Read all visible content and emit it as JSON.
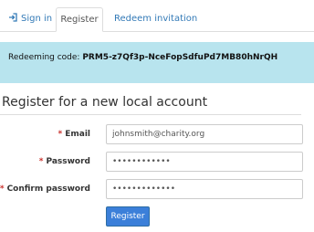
{
  "tabs": [
    {
      "label": "Sign in",
      "icon": "sign-in-icon",
      "active": false
    },
    {
      "label": "Register",
      "active": true
    },
    {
      "label": "Redeem invitation",
      "active": false
    }
  ],
  "alert": {
    "prefix": "Redeeming code: ",
    "code": "PRM5-z7Qf3p-NceFopSdfuPd7MB80hNrQH"
  },
  "form": {
    "heading": "Register for a new local account",
    "email_label": "Email",
    "email_value": "johnsmith@charity.org",
    "password_label": "Password",
    "password_value": "••••••••••••",
    "confirm_label": "Confirm password",
    "confirm_value": "•••••••••••••",
    "required_marker": "*",
    "submit_label": "Register"
  },
  "colors": {
    "link": "#337ab7",
    "alert_bg": "#b8e4ee",
    "required": "#c9302c",
    "button_bg": "#3b7fd9"
  }
}
